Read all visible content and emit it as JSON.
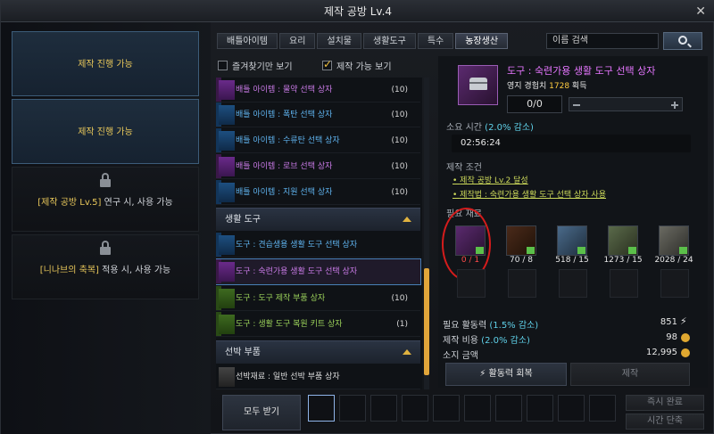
{
  "window": {
    "title": "제작 공방 Lv.4",
    "close_label": "✕"
  },
  "slots": [
    {
      "text": "제작 진행 가능",
      "locked": false
    },
    {
      "text": "제작 진행 가능",
      "locked": false
    },
    {
      "highlight": "[제작 공방 Lv.5]",
      "text": " 연구 시, 사용 가능",
      "locked": true
    },
    {
      "highlight": "[니나브의 축복]",
      "text": " 적용 시, 사용 가능",
      "locked": true
    }
  ],
  "tabs": [
    {
      "label": "배틀아이템",
      "active": false
    },
    {
      "label": "요리",
      "active": false
    },
    {
      "label": "설치물",
      "active": false
    },
    {
      "label": "생활도구",
      "active": false
    },
    {
      "label": "특수",
      "active": false
    },
    {
      "label": "농장생산",
      "active": true
    }
  ],
  "search": {
    "placeholder": "이름 검색"
  },
  "filters": {
    "favorites": {
      "label": "즐겨찾기만 보기",
      "checked": false
    },
    "craftable": {
      "label": "제작 가능 보기",
      "checked": true
    }
  },
  "list": {
    "rows": [
      {
        "name": "배틀 아이템 : 물약 선택 상자",
        "count": "(10)",
        "grade": "purple"
      },
      {
        "name": "배틀 아이템 : 폭탄 선택 상자",
        "count": "(10)",
        "grade": "blue"
      },
      {
        "name": "배틀 아이템 : 수류탄 선택 상자",
        "count": "(10)",
        "grade": "blue"
      },
      {
        "name": "배틀 아이템 : 로브 선택 상자",
        "count": "(10)",
        "grade": "purple"
      },
      {
        "name": "배틀 아이템 : 지원 선택 상자",
        "count": "(10)",
        "grade": "blue"
      }
    ],
    "section_tools": "생활 도구",
    "tool_rows": [
      {
        "name": "도구 : 견습생용 생활 도구 선택 상자",
        "count": "",
        "grade": "blue"
      },
      {
        "name": "도구 : 숙련가용 생활 도구 선택 상자",
        "count": "",
        "grade": "purple"
      },
      {
        "name": "도구 : 도구 제작 부품 상자",
        "count": "(10)",
        "grade": "green"
      },
      {
        "name": "도구 : 생활 도구 복원 키트 상자",
        "count": "(1)",
        "grade": "green"
      }
    ],
    "section_ship": "선박 부품",
    "ship_rows": [
      {
        "name": "선박재료 : 일반 선박 부품 상자",
        "count": "",
        "grade": "white"
      }
    ]
  },
  "detail": {
    "title": "도구 : 숙련가용 생활 도구 선택 상자",
    "exp_label": "영지 경험치",
    "exp_value": "1728",
    "exp_suffix": "획득",
    "quantity": "0/0",
    "time_label": "소요 시간",
    "time_discount": "(2.0% 감소)",
    "time_value": "02:56:24",
    "cond_label": "제작 조건",
    "conditions": [
      "제작 공방 Lv.2 달성",
      "제작법 : 숙련가용 생활 도구 선택 상자 사용"
    ],
    "materials_label": "필요 재료",
    "materials": [
      {
        "name": "chest-material",
        "value": "0 / 1",
        "short": true
      },
      {
        "name": "rope-material",
        "value": "70 / 8",
        "short": false
      },
      {
        "name": "crystal-material",
        "value": "518 / 15",
        "short": false
      },
      {
        "name": "ore-material",
        "value": "1273 / 15",
        "short": false
      },
      {
        "name": "scrap-material",
        "value": "2028 / 24",
        "short": false
      }
    ],
    "stats": [
      {
        "label": "필요 활동력",
        "discount": "(1.5% 감소)",
        "value": "851",
        "icon": "bolt"
      },
      {
        "label": "제작 비용",
        "discount": "(2.0% 감소)",
        "value": "98",
        "icon": "coin"
      },
      {
        "label": "소지 금액",
        "discount": "",
        "value": "12,995",
        "icon": "coin"
      }
    ],
    "recover_btn": "활동력 회복",
    "craft_btn": "제작"
  },
  "bottom": {
    "receive_all": "모두 받기",
    "instant_finish": "즉시 완료",
    "time_reduce": "시간 단축"
  }
}
